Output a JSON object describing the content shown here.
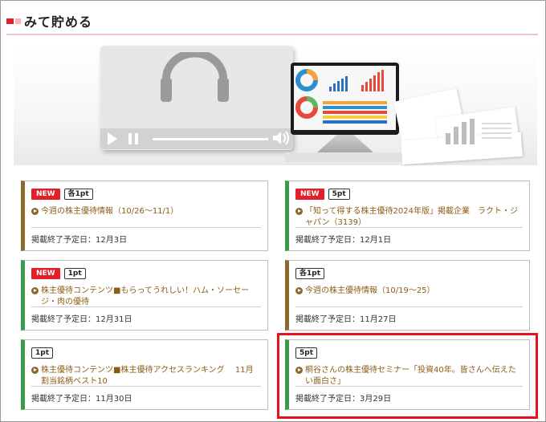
{
  "section": {
    "title": "みて貯める"
  },
  "hero": {
    "icon": "headphones-icon",
    "controls": [
      "play-icon",
      "pause-icon",
      "volume-icon"
    ]
  },
  "cards": [
    {
      "new_label": "NEW",
      "points": "各1pt",
      "title": "今週の株主優待情報（10/26～11/1）",
      "deadline": "掲載終了予定日：12月3日",
      "accent": "#8c6a2e"
    },
    {
      "new_label": "NEW",
      "points": "5pt",
      "title": "「知って得する株主優待2024年版」掲載企業　ラクト・ジャパン（3139）",
      "deadline": "掲載終了予定日：12月1日",
      "accent": "#3d9a4c"
    },
    {
      "new_label": "NEW",
      "points": "1pt",
      "title": "株主優待コンテンツ■もらってうれしい！ハム・ソーセージ・肉の優待",
      "deadline": "掲載終了予定日：12月31日",
      "accent": "#3d9a4c"
    },
    {
      "new_label": "",
      "points": "各1pt",
      "title": "今週の株主優待情報（10/19～25）",
      "deadline": "掲載終了予定日：11月27日",
      "accent": "#8c6a2e"
    },
    {
      "new_label": "",
      "points": "1pt",
      "title": "株主優待コンテンツ■株主優待アクセスランキング　 11月割当銘柄ベスト10",
      "deadline": "掲載終了予定日：11月30日",
      "accent": "#3d9a4c"
    },
    {
      "new_label": "",
      "points": "5pt",
      "title": "桐谷さんの株主優待セミナー「投資40年。皆さんへ伝えたい面白さ」",
      "deadline": "掲載終了予定日：3月29日",
      "accent": "#3d9a4c"
    }
  ],
  "colors": {
    "new_badge": "#e31f2b",
    "link_text": "#8c5d14",
    "highlight_box": "#e8101b",
    "accent_green": "#3d9a4c",
    "accent_brown": "#8c6a2e"
  }
}
